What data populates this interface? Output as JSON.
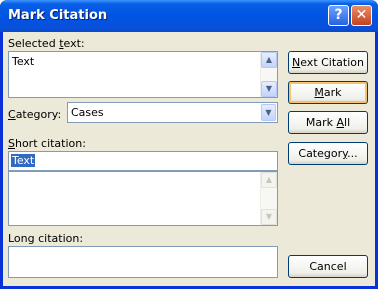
{
  "window": {
    "title": "Mark Citation",
    "help_glyph": "?",
    "close_glyph": "✕"
  },
  "selected_text": {
    "label_pre": "Selected ",
    "label_accel": "t",
    "label_post": "ext:",
    "value": "Text"
  },
  "category": {
    "label_pre": "",
    "label_accel": "C",
    "label_post": "ategory:",
    "value": "Cases"
  },
  "short_citation": {
    "label_pre": "",
    "label_accel": "S",
    "label_post": "hort citation:",
    "value": "Text"
  },
  "long_citation": {
    "label": "Long citation:",
    "value": ""
  },
  "buttons": {
    "next_pre": "",
    "next_accel": "N",
    "next_post": "ext Citation",
    "mark_pre": "",
    "mark_accel": "M",
    "mark_post": "ark",
    "markall_pre": "Mark ",
    "markall_accel": "A",
    "markall_post": "ll",
    "category_pre": "Categor",
    "category_accel": "y",
    "category_post": "...",
    "cancel": "Cancel"
  },
  "icons": {
    "scroll_up": "▲",
    "scroll_down": "▼",
    "dropdown": "▼"
  }
}
